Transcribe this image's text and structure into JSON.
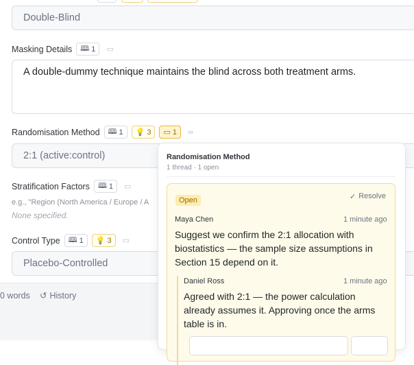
{
  "fields": {
    "blinding": {
      "value": "Double-Blind"
    },
    "masking": {
      "label": "Masking Details",
      "ref_count": "1",
      "value": "A double-dummy technique maintains the blind across both treatment arms."
    },
    "randomisation": {
      "label": "Randomisation Method",
      "ref_count": "1",
      "idea_count": "3",
      "comment_count": "1",
      "value": "2:1 (active:control)"
    },
    "stratification": {
      "label": "Stratification Factors",
      "ref_count": "1",
      "hint": "e.g., \"Region (North America / Europe / A",
      "empty": "None specified."
    },
    "control": {
      "label": "Control Type",
      "ref_count": "1",
      "idea_count": "3",
      "value": "Placebo-Controlled"
    }
  },
  "footer": {
    "words": "0 words",
    "history": "History"
  },
  "popover": {
    "title": "Randomisation Method",
    "subtitle": "1 thread · 1 open",
    "thread": {
      "status": "Open",
      "resolve_label": "Resolve",
      "comments": [
        {
          "author": "Maya Chen",
          "time": "1 minute ago",
          "text": "Suggest we confirm the 2:1 allocation with biostatistics — the sample size assumptions in Section 15 depend on it."
        },
        {
          "author": "Daniel Ross",
          "time": "1 minute ago",
          "text": "Agreed with 2:1 — the power calculation already assumes it. Approving once the arms table is in."
        }
      ]
    }
  },
  "colors": {
    "accent_yellow": "#f1d27a",
    "open_badge_bg": "#fdedb0",
    "field_bg": "#f7f8fa"
  }
}
